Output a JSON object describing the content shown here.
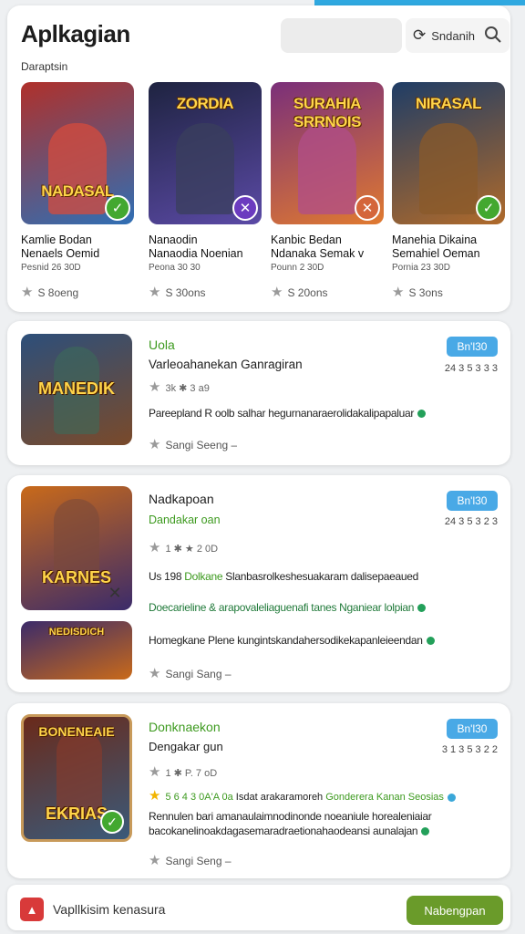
{
  "header": {
    "title": "Aplkagian",
    "subtitle": "Daraptsin",
    "sort_label": "Sndanih"
  },
  "featured": [
    {
      "logo": "NADASAL",
      "name1": "Kamlie Bodan",
      "name2": "Nenaels Oemid",
      "meta": "Pesnid 26 30D",
      "rating": "S 8oeng",
      "bg": "#b0302a",
      "bg2": "#2f6fb5",
      "badge": "✓",
      "badge_color": "#43a830"
    },
    {
      "logo": "ZORDIA",
      "name1": "Nanaodin",
      "name2": "Nanaodia Noenian",
      "meta": "Peona 30 30",
      "rating": "S 30ons",
      "bg": "#1e2340",
      "bg2": "#5b4aa6",
      "badge": "✕",
      "badge_color": "#6b3bbf"
    },
    {
      "logo": "SURAHIA SRRNOIS",
      "name1": "Kanbic Bedan",
      "name2": "Ndanaka Semak v",
      "meta": "Pounn 2 30D",
      "rating": "S 20ons",
      "bg": "#7a2f7a",
      "bg2": "#e07a30",
      "badge": "✕",
      "badge_color": "#d4663b"
    },
    {
      "logo": "NIRASAL",
      "name1": "Manehia Dikaina",
      "name2": "Semahiel Oeman",
      "meta": "Pornia 23 30D",
      "rating": "S 3ons",
      "bg": "#1f3d66",
      "bg2": "#b06a2a",
      "badge": "✓",
      "badge_color": "#43a830"
    }
  ],
  "items": [
    {
      "logo": "MANEDIK",
      "bg": "#2d4f7a",
      "bg2": "#7a4a2a",
      "category": "Uola",
      "title": "Varleoahanekan Ganragiran",
      "rating": "3k ✱ 3 a9",
      "tag": "Bn'l30",
      "version": "24 3 5 3 3 3",
      "desc": "Pareepland R oolb salhar hegurnanaraerolidakalipapaluar",
      "footer": "Sangi  Seeng  –"
    },
    {
      "logo": "KARNES",
      "bg": "#c96a1a",
      "bg2": "#3b2b6a",
      "title": "Nadkapoan",
      "category": "Dandakar oan",
      "rating": "1 ✱ ★ 2 0D",
      "tag": "Bn'l30",
      "version": "24 3 5 3 2 3",
      "line1_a": "Us 198",
      "line1_b": "Dolkane",
      "line1_c": "Slanbasrolkeshesuakaram dalisepaeaued",
      "line2": "Doecarieline & arapovaleliaguenafi tanes Nganiear lolpian",
      "logo2": "NEDISDICH",
      "desc": "Homegkane Plene kungintskandahersodikekapanleieendan",
      "footer": "Sangi  Sang  –"
    },
    {
      "logo": "EKRIAS",
      "bg": "#6a2a1a",
      "bg2": "#3a5a7a",
      "category": "Donknaekon",
      "title": "Dengakar gun",
      "rating": "1 ✱ P. 7 oD",
      "tag": "Bn'l30",
      "version": "3 1 3 5 3 2 2",
      "line1_a": "5 6 4 3 0A'A 0a",
      "line1_b": "Isdat arakaramoreh",
      "line1_c": "Gonderera Kanan Seosias",
      "desc1": "Rennulen bari amanaulaimnodinonde noeaniule horealeniaiar",
      "desc2": "bacokanelinoakdagasemaradraetionahaodeansi aunalajan",
      "footer": "Sangi  Seng  –"
    }
  ],
  "bottom_bar": {
    "text": "Vapllkisim kenasura",
    "button": "Nabengpan"
  }
}
